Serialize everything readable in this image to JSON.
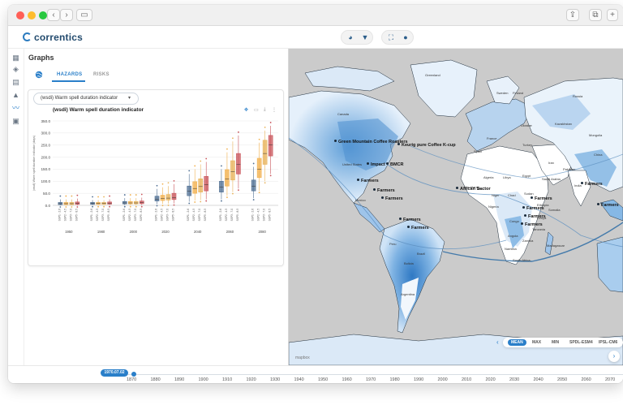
{
  "app": {
    "name": "correntics",
    "panel_title": "Graphs",
    "tabs": [
      "HAZARDS",
      "RISKS"
    ],
    "active_tab": "HAZARDS",
    "watermark": "mapbox"
  },
  "indicator_select": {
    "value": "(wsdi) Warm spell duration indicator"
  },
  "chart_data": {
    "type": "box",
    "title": "(wsdi) Warm spell duration indicator",
    "ylabel": "(wsdi) Warm spell duration indicator (days)",
    "ylim": [
      0,
      350
    ],
    "yticks": [
      "0.0",
      "50.0",
      "100.0",
      "150.0",
      "200.0",
      "250.0",
      "300.0",
      "350.0"
    ],
    "groups": [
      "1950",
      "1980",
      "2000",
      "2020",
      "2040",
      "2060",
      "2080"
    ],
    "scenarios": [
      "SSP1 - 2.6",
      "SSP2 - 4.5",
      "SSP3 - 7.0",
      "SSP5 - 8.5"
    ],
    "colors": [
      "#4f6f93",
      "#f2b04d",
      "#e8b35a",
      "#c9545a"
    ],
    "medians": [
      [
        7,
        7,
        7,
        8
      ],
      [
        8,
        8,
        8,
        9
      ],
      [
        10,
        10,
        10,
        11
      ],
      [
        26,
        28,
        30,
        32
      ],
      [
        58,
        70,
        78,
        85
      ],
      [
        75,
        110,
        140,
        170
      ],
      [
        80,
        150,
        215,
        250
      ]
    ],
    "q1": [
      [
        3,
        3,
        3,
        4
      ],
      [
        4,
        4,
        4,
        5
      ],
      [
        6,
        6,
        6,
        7
      ],
      [
        18,
        20,
        22,
        24
      ],
      [
        40,
        50,
        55,
        60
      ],
      [
        55,
        80,
        105,
        130
      ],
      [
        60,
        115,
        170,
        205
      ]
    ],
    "q3": [
      [
        12,
        12,
        12,
        14
      ],
      [
        12,
        12,
        12,
        14
      ],
      [
        16,
        16,
        16,
        18
      ],
      [
        38,
        42,
        45,
        50
      ],
      [
        80,
        98,
        110,
        120
      ],
      [
        100,
        148,
        185,
        215
      ],
      [
        105,
        195,
        270,
        290
      ]
    ],
    "mins": [
      [
        0,
        0,
        0,
        0
      ],
      [
        1,
        1,
        1,
        1
      ],
      [
        1,
        1,
        1,
        1
      ],
      [
        5,
        6,
        7,
        8
      ],
      [
        15,
        20,
        22,
        25
      ],
      [
        25,
        40,
        55,
        70
      ],
      [
        30,
        60,
        100,
        130
      ]
    ],
    "maxs": [
      [
        25,
        25,
        25,
        28
      ],
      [
        22,
        22,
        22,
        25
      ],
      [
        30,
        30,
        30,
        32
      ],
      [
        68,
        75,
        80,
        88
      ],
      [
        130,
        150,
        170,
        180
      ],
      [
        150,
        220,
        265,
        290
      ],
      [
        160,
        260,
        310,
        330
      ]
    ]
  },
  "map": {
    "labels": [
      "Green Mountain Coffee Roasters",
      "Keurig pure Coffee K-cup",
      "Impact",
      "BMCR",
      "Farmers",
      "Farmers",
      "Farmers",
      "Farmers",
      "Farmers",
      "African Sector",
      "Farmers",
      "Farmers",
      "Farmers",
      "Farmers",
      "Farmers",
      "Farmers"
    ],
    "countries": [
      "Greenland",
      "Canada",
      "United States",
      "Mexico",
      "Brazil",
      "Peru",
      "Bolivia",
      "Argentina",
      "Algeria",
      "Libya",
      "Egypt",
      "Niger",
      "Chad",
      "Sudan",
      "Nigeria",
      "Congo",
      "Kenya",
      "Namibia",
      "South Africa",
      "Madagascar",
      "Ethiopia",
      "Somalia",
      "Tanzania",
      "Angola",
      "Zambia",
      "Mongolia",
      "China",
      "India",
      "Iran",
      "Pakistan",
      "Turkey",
      "Ukraine",
      "France",
      "Spain",
      "Sweden",
      "Finland",
      "Saudi Arabia",
      "Mauritania",
      "Mali",
      "Kazakhstan",
      "Russia"
    ],
    "legend": [
      "MEAN",
      "MAX",
      "MIN",
      "SPDL-ESM4",
      "IPSL-CM6"
    ],
    "active_legend": "MEAN"
  },
  "timeline": {
    "current_date": "1970.07.02",
    "years": [
      "1870",
      "1880",
      "1890",
      "1900",
      "1910",
      "1920",
      "1930",
      "1940",
      "1950",
      "1960",
      "1970",
      "1980",
      "1990",
      "2000",
      "2010",
      "2020",
      "2030",
      "2040",
      "2050",
      "2060",
      "2070"
    ]
  }
}
